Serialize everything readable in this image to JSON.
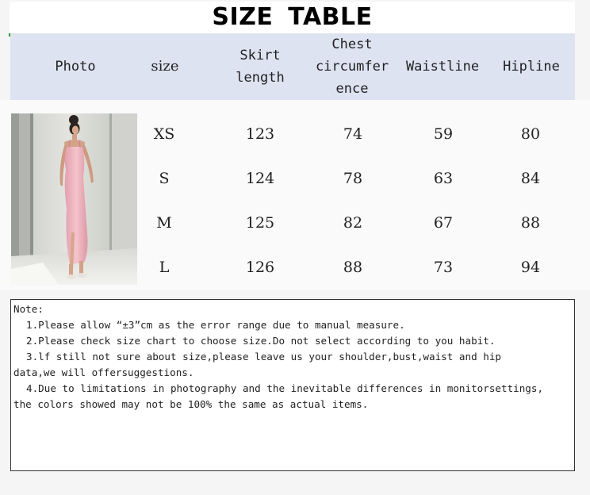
{
  "title": "SIZE  TABLE",
  "headers": {
    "photo": "Photo",
    "size": "size",
    "skirt_length": [
      "Skirt",
      "length"
    ],
    "chest": [
      "Chest",
      "circumfer",
      "ence"
    ],
    "waistline": "Waistline",
    "hipline": "Hipline"
  },
  "rows": [
    {
      "size": "XS",
      "skirt": "123",
      "chest": "74",
      "waist": "59",
      "hip": "80"
    },
    {
      "size": "S",
      "skirt": "124",
      "chest": "78",
      "waist": "63",
      "hip": "84"
    },
    {
      "size": "M",
      "skirt": "125",
      "chest": "82",
      "waist": "67",
      "hip": "88"
    },
    {
      "size": "L",
      "skirt": "126",
      "chest": "88",
      "waist": "73",
      "hip": "94"
    }
  ],
  "notes": {
    "heading": "Note:",
    "items": [
      "1.Please allow “±3”cm as the error range due to manual measure.",
      "2.Please check size chart to choose size.Do not select according to you habit.",
      "3.lf still not sure about size,please leave us your shoulder,bust,waist and hip",
      "data,we will offersuggestions.",
      "4.Due to limitations in photography and the inevitable differences in monitorsettings,",
      "the colors showed may not be 100% the same as actual items."
    ]
  },
  "colors": {
    "header_bg": "#dde3f1",
    "dress": "#eeb2bd"
  }
}
